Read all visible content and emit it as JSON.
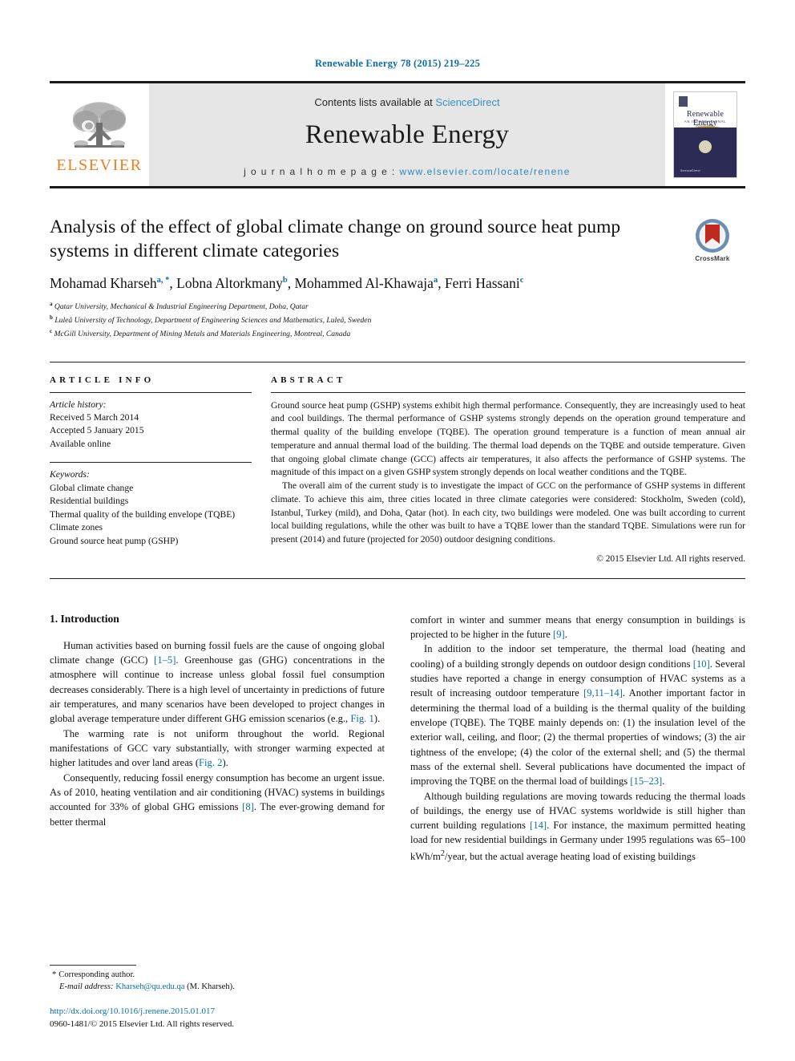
{
  "journal_ref": "Renewable Energy 78 (2015) 219–225",
  "masthead": {
    "contents_prefix": "Contents lists available at ",
    "sciencedirect": "ScienceDirect",
    "journal_title": "Renewable Energy",
    "homepage_prefix": "j o u r n a l   h o m e p a g e :  ",
    "homepage_url": "www.elsevier.com/locate/renene",
    "publisher_name": "ELSEVIER",
    "cover": {
      "title": "Renewable Energy",
      "subtitle": "AN INTERNATIONAL JOURNAL",
      "editors": "EDITOR-IN-CHIEF: A. A. M. Sayigh",
      "footer": "ScienceDirect"
    }
  },
  "article": {
    "title": "Analysis of the effect of global climate change on ground source heat pump systems in different climate categories",
    "crossmark_label": "CrossMark",
    "authors": [
      {
        "name": "Mohamad Kharseh",
        "marks": "a, *"
      },
      {
        "name": "Lobna Altorkmany",
        "marks": "b"
      },
      {
        "name": "Mohammed Al-Khawaja",
        "marks": "a"
      },
      {
        "name": "Ferri Hassani",
        "marks": "c"
      }
    ],
    "affiliations": [
      {
        "mark": "a",
        "text": "Qatar University, Mechanical & Industrial Engineering Department, Doha, Qatar"
      },
      {
        "mark": "b",
        "text": "Luleå University of Technology, Department of Engineering Sciences and Mathematics, Luleå, Sweden"
      },
      {
        "mark": "c",
        "text": "McGill University, Department of Mining Metals and Materials Engineering, Montreal, Canada"
      }
    ]
  },
  "article_info": {
    "heading": "ARTICLE INFO",
    "history_label": "Article history:",
    "history": [
      "Received 5 March 2014",
      "Accepted 5 January 2015",
      "Available online"
    ],
    "keywords_label": "Keywords:",
    "keywords": [
      "Global climate change",
      "Residential buildings",
      "Thermal quality of the building envelope (TQBE)",
      "Climate zones",
      "Ground source heat pump (GSHP)"
    ]
  },
  "abstract": {
    "heading": "ABSTRACT",
    "paragraphs": [
      "Ground source heat pump (GSHP) systems exhibit high thermal performance. Consequently, they are increasingly used to heat and cool buildings. The thermal performance of GSHP systems strongly depends on the operation ground temperature and thermal quality of the building envelope (TQBE). The operation ground temperature is a function of mean annual air temperature and annual thermal load of the building. The thermal load depends on the TQBE and outside temperature. Given that ongoing global climate change (GCC) affects air temperatures, it also affects the performance of GSHP systems. The magnitude of this impact on a given GSHP system strongly depends on local weather conditions and the TQBE.",
      "The overall aim of the current study is to investigate the impact of GCC on the performance of GSHP systems in different climate. To achieve this aim, three cities located in three climate categories were considered: Stockholm, Sweden (cold), Istanbul, Turkey (mild), and Doha, Qatar (hot). In each city, two buildings were modeled. One was built according to current local building regulations, while the other was built to have a TQBE lower than the standard TQBE. Simulations were run for present (2014) and future (projected for 2050) outdoor designing conditions."
    ],
    "copyright": "© 2015 Elsevier Ltd. All rights reserved."
  },
  "body": {
    "section_number_title": "1.  Introduction",
    "left_paragraphs": [
      "Human activities based on burning fossil fuels are the cause of ongoing global climate change (GCC) [1–5]. Greenhouse gas (GHG) concentrations in the atmosphere will continue to increase unless global fossil fuel consumption decreases considerably. There is a high level of uncertainty in predictions of future air temperatures, and many scenarios have been developed to project changes in global average temperature under different GHG emission scenarios (e.g., Fig. 1).",
      "The warming rate is not uniform throughout the world. Regional manifestations of GCC vary substantially, with stronger warming expected at higher latitudes and over land areas (Fig. 2).",
      "Consequently, reducing fossil energy consumption has become an urgent issue. As of 2010, heating ventilation and air conditioning (HVAC) systems in buildings accounted for 33% of global GHG emissions [8]. The ever-growing demand for better thermal"
    ],
    "right_paragraphs": [
      "comfort in winter and summer means that energy consumption in buildings is projected to be higher in the future [9].",
      "In addition to the indoor set temperature, the thermal load (heating and cooling) of a building strongly depends on outdoor design conditions [10]. Several studies have reported a change in energy consumption of HVAC systems as a result of increasing outdoor temperature [9,11–14]. Another important factor in determining the thermal load of a building is the thermal quality of the building envelope (TQBE). The TQBE mainly depends on: (1) the insulation level of the exterior wall, ceiling, and floor; (2) the thermal properties of windows; (3) the air tightness of the envelope; (4) the color of the external shell; and (5) the thermal mass of the external shell. Several publications have documented the impact of improving the TQBE on the thermal load of buildings [15–23].",
      "Although building regulations are moving towards reducing the thermal loads of buildings, the energy use of HVAC systems worldwide is still higher than current building regulations [14]. For instance, the maximum permitted heating load for new residential buildings in Germany under 1995 regulations was 65–100 kWh/m2/year, but the actual average heating load of existing buildings"
    ]
  },
  "footnote": {
    "corresponding_author": "Corresponding author.",
    "email_label": "E-mail address:",
    "email": "Kharseh@qu.edu.qa",
    "email_owner": "(M. Kharseh).",
    "doi": "http://dx.doi.org/10.1016/j.renene.2015.01.017",
    "issn_line": "0960-1481/© 2015 Elsevier Ltd. All rights reserved."
  },
  "colors": {
    "link_blue": "#0b6ea8",
    "elsevier_orange": "#f47b20",
    "masthead_gray": "#e6e6e6",
    "cover_navy": "#2b2b55",
    "cover_gold": "#c9a227"
  }
}
